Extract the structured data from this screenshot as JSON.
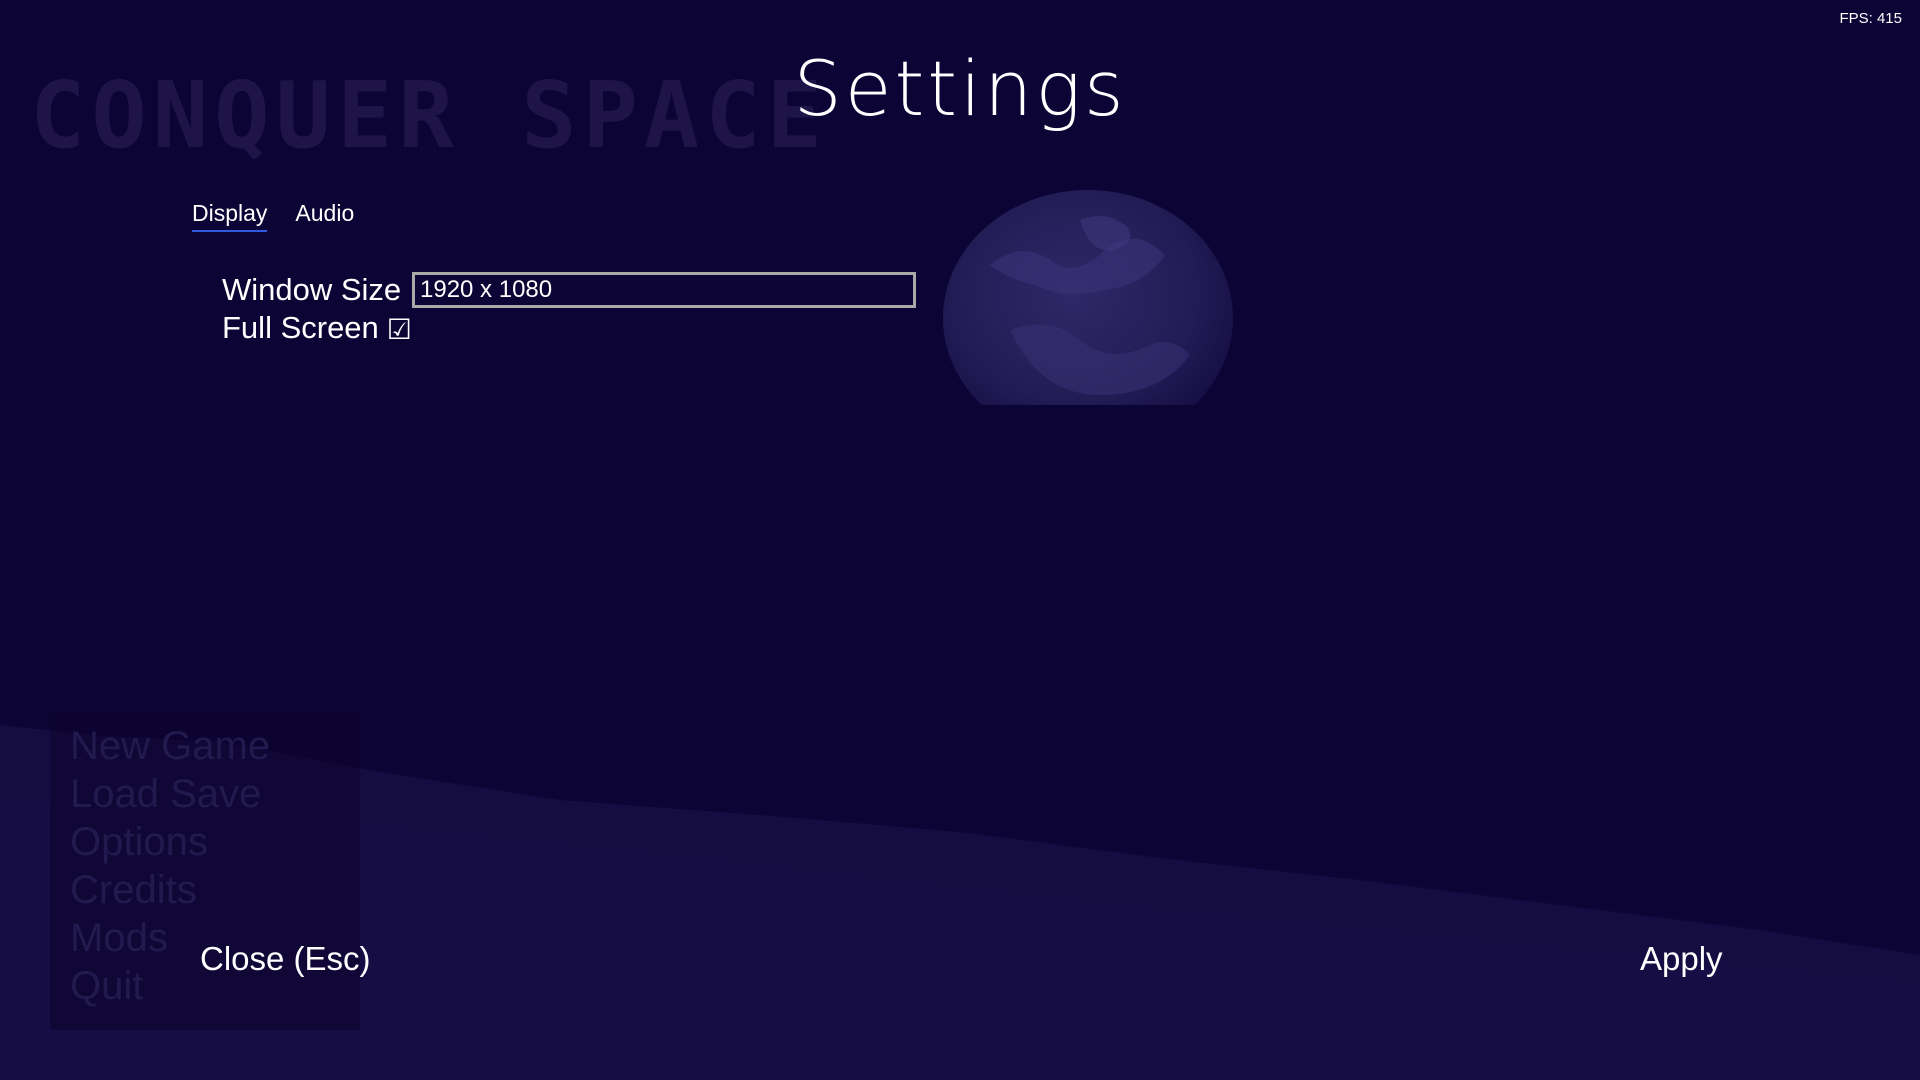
{
  "window": {
    "fps_label": "FPS: 415"
  },
  "background": {
    "logo_text": "CONQUER SPACE",
    "main_menu": [
      "New Game",
      "Load Save",
      "Options",
      "Credits",
      "Mods",
      "Quit"
    ]
  },
  "header": {
    "title": "Settings"
  },
  "tabs": [
    {
      "label": "Display",
      "active": true
    },
    {
      "label": "Audio",
      "active": false
    }
  ],
  "display": {
    "window_size_label": "Window Size",
    "window_size_value": "1920 x 1080",
    "full_screen_label": "Full Screen",
    "full_screen_checked": true,
    "checkbox_glyph": "☑"
  },
  "footer": {
    "close_label": "Close (Esc)",
    "apply_label": "Apply"
  },
  "colors": {
    "background": "#0c0434",
    "tab_underline": "#2f5ae0",
    "select_border": "#a9a9a9",
    "text": "#ffffff"
  }
}
